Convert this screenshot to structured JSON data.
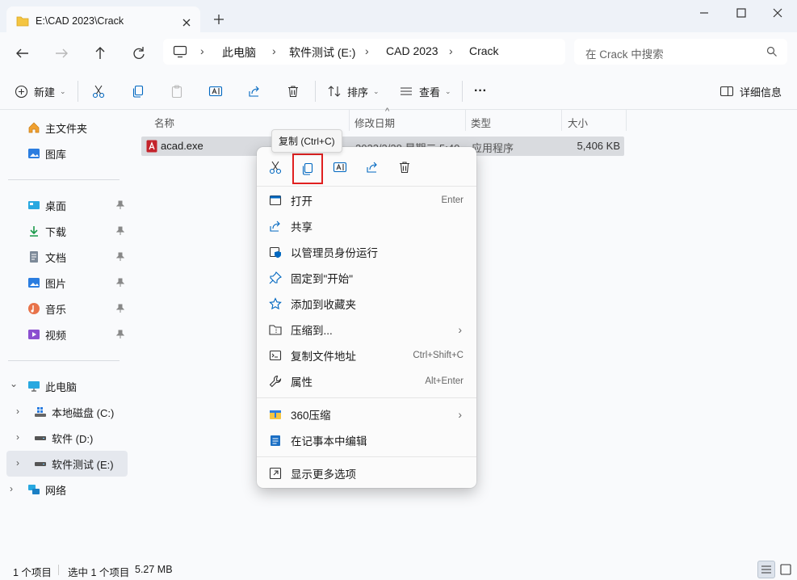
{
  "window": {
    "tab_title": "E:\\CAD 2023\\Crack",
    "new_tab_symbol": "+",
    "close_symbol": "✕",
    "minimize_symbol": "—",
    "maximize_symbol": "☐"
  },
  "nav": {
    "breadcrumb": [
      "此电脑",
      "软件测试 (E:)",
      "CAD 2023",
      "Crack"
    ],
    "separator": "›",
    "search_placeholder": "在 Crack 中搜索"
  },
  "toolbar": {
    "new_label": "新建",
    "sort_label": "排序",
    "view_label": "查看",
    "more_label": "···",
    "details_label": "详细信息",
    "dropdown_symbol": "⌄"
  },
  "sidebar": {
    "quick": [
      {
        "label": "主文件夹",
        "icon": "home-icon"
      },
      {
        "label": "图库",
        "icon": "gallery-icon"
      }
    ],
    "pinned": [
      {
        "label": "桌面",
        "icon": "desktop-icon"
      },
      {
        "label": "下载",
        "icon": "download-icon"
      },
      {
        "label": "文档",
        "icon": "document-icon"
      },
      {
        "label": "图片",
        "icon": "pictures-icon"
      },
      {
        "label": "音乐",
        "icon": "music-icon"
      },
      {
        "label": "视频",
        "icon": "video-icon"
      }
    ],
    "this_pc": "此电脑",
    "drives": [
      {
        "label": "本地磁盘 (C:)",
        "icon": "windows-drive-icon"
      },
      {
        "label": "软件 (D:)",
        "icon": "drive-icon"
      },
      {
        "label": "软件测试 (E:)",
        "icon": "drive-icon",
        "selected": true
      }
    ],
    "network": "网络",
    "chevron_right": "›",
    "chevron_down": "⌄"
  },
  "columns": {
    "name": "名称",
    "modified": "修改日期",
    "type": "类型",
    "size": "大小",
    "sort_symbol": "^"
  },
  "files": [
    {
      "name": "acad.exe",
      "modified": "2023/3/28 星期二 5:40",
      "type": "应用程序",
      "size": "5,406 KB"
    }
  ],
  "status": {
    "item_count": "1 个项目",
    "selected": "选中 1 个项目",
    "selected_size": "5.27 MB"
  },
  "tooltip": "复制 (Ctrl+C)",
  "context_menu": {
    "items": [
      {
        "label": "打开",
        "shortcut": "Enter",
        "icon": "open-icon"
      },
      {
        "label": "共享",
        "shortcut": "",
        "icon": "share-icon"
      },
      {
        "label": "以管理员身份运行",
        "shortcut": "",
        "icon": "shield-icon"
      },
      {
        "label": "固定到\"开始\"",
        "shortcut": "",
        "icon": "pin-icon"
      },
      {
        "label": "添加到收藏夹",
        "shortcut": "",
        "icon": "star-icon"
      },
      {
        "label": "压缩到...",
        "shortcut": "",
        "icon": "zip-icon",
        "submenu": true
      },
      {
        "label": "复制文件地址",
        "shortcut": "Ctrl+Shift+C",
        "icon": "copy-path-icon"
      },
      {
        "label": "属性",
        "shortcut": "Alt+Enter",
        "icon": "wrench-icon"
      }
    ],
    "extra": [
      {
        "label": "360压缩",
        "icon": "360-zip-icon",
        "submenu": true
      },
      {
        "label": "在记事本中编辑",
        "icon": "notepad-icon"
      }
    ],
    "more": {
      "label": "显示更多选项",
      "icon": "more-options-icon"
    },
    "submenu_arrow": "›"
  },
  "colors": {
    "accent": "#0067c0",
    "highlight_border": "#e02020",
    "autocad_red": "#c4232b",
    "folder_yellow": "#f4c542"
  }
}
